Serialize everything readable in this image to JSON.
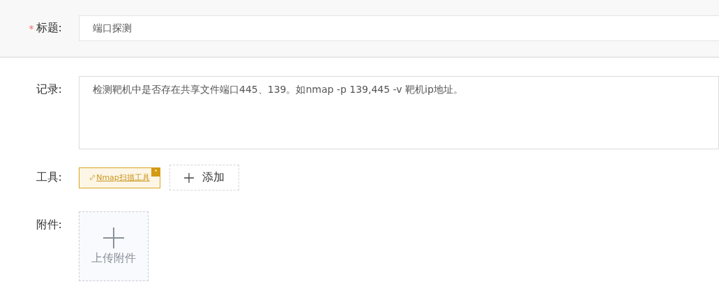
{
  "title_field": {
    "label": "标题:",
    "required": true,
    "required_mark": "*",
    "value": "端口探测"
  },
  "record_field": {
    "label": "记录:",
    "value": "检测靶机中是否存在共享文件端口445、139。如nmap -p 139,445 -v 靶机ip地址。"
  },
  "tools_field": {
    "label": "工具:",
    "tags": [
      {
        "text": "Nmap扫描工具"
      }
    ],
    "add_button": "添加"
  },
  "attachment_field": {
    "label": "附件:",
    "upload_label": "上传附件"
  }
}
